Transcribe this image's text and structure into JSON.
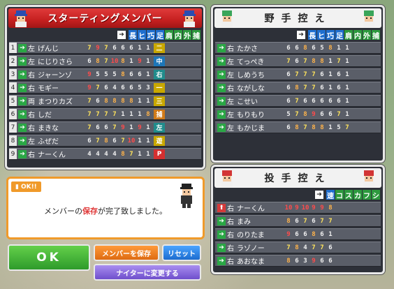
{
  "starting": {
    "title": "スターティングメンバー",
    "headers": [
      "長",
      "ヒ",
      "巧",
      "足",
      "肩",
      "内",
      "外",
      "捕"
    ],
    "players": [
      {
        "order": "1",
        "hand": "左",
        "name": "げんじ",
        "stats": [
          "7",
          "9",
          "7",
          "6",
          "6",
          "6",
          "1",
          "1"
        ],
        "pos": "二"
      },
      {
        "order": "2",
        "hand": "左",
        "name": "にじりさら",
        "stats": [
          "6",
          "8",
          "7",
          "10",
          "8",
          "1",
          "9",
          "1"
        ],
        "pos": "中"
      },
      {
        "order": "3",
        "hand": "右",
        "name": "ジャーンゾ",
        "stats": [
          "9",
          "5",
          "5",
          "5",
          "8",
          "6",
          "6",
          "1"
        ],
        "pos": "右"
      },
      {
        "order": "4",
        "hand": "右",
        "name": "モギー",
        "stats": [
          "9",
          "7",
          "6",
          "4",
          "6",
          "6",
          "5",
          "3"
        ],
        "pos": "一"
      },
      {
        "order": "5",
        "hand": "両",
        "name": "まつりカズ",
        "stats": [
          "7",
          "6",
          "8",
          "8",
          "8",
          "8",
          "1",
          "1"
        ],
        "pos": "三"
      },
      {
        "order": "6",
        "hand": "右",
        "name": "しだ",
        "stats": [
          "7",
          "7",
          "7",
          "7",
          "1",
          "1",
          "1",
          "8"
        ],
        "pos": "捕"
      },
      {
        "order": "7",
        "hand": "右",
        "name": "まきな",
        "stats": [
          "7",
          "6",
          "6",
          "7",
          "9",
          "1",
          "9",
          "1"
        ],
        "pos": "左"
      },
      {
        "order": "8",
        "hand": "左",
        "name": "ふぜだ",
        "stats": [
          "6",
          "7",
          "8",
          "6",
          "7",
          "10",
          "1",
          "1"
        ],
        "pos": "遊"
      },
      {
        "order": "9",
        "hand": "右",
        "name": "ナーくん",
        "stats": [
          "4",
          "4",
          "4",
          "4",
          "8",
          "7",
          "1",
          "1"
        ],
        "pos": "P"
      }
    ]
  },
  "fielders": {
    "title": "野手控え",
    "headers": [
      "長",
      "ヒ",
      "巧",
      "足",
      "肩",
      "内",
      "外",
      "捕"
    ],
    "players": [
      {
        "hand": "右",
        "name": "たかさ",
        "stats": [
          "6",
          "6",
          "8",
          "6",
          "5",
          "8",
          "1",
          "1"
        ]
      },
      {
        "hand": "左",
        "name": "てっぺき",
        "stats": [
          "7",
          "6",
          "7",
          "8",
          "8",
          "1",
          "7",
          "1"
        ]
      },
      {
        "hand": "左",
        "name": "しめうち",
        "stats": [
          "6",
          "7",
          "7",
          "7",
          "6",
          "1",
          "6",
          "1"
        ]
      },
      {
        "hand": "右",
        "name": "ながしな",
        "stats": [
          "6",
          "8",
          "7",
          "7",
          "6",
          "1",
          "6",
          "1"
        ]
      },
      {
        "hand": "左",
        "name": "こせい",
        "stats": [
          "6",
          "7",
          "6",
          "6",
          "6",
          "6",
          "6",
          "1"
        ]
      },
      {
        "hand": "左",
        "name": "もりもり",
        "stats": [
          "5",
          "7",
          "8",
          "9",
          "6",
          "6",
          "7",
          "1"
        ]
      },
      {
        "hand": "左",
        "name": "もかじま",
        "stats": [
          "6",
          "8",
          "7",
          "8",
          "8",
          "1",
          "5",
          "7"
        ]
      }
    ]
  },
  "pitchers": {
    "title": "投手控え",
    "headers": [
      "速",
      "コ",
      "ス",
      "カ",
      "フ",
      "シ"
    ],
    "players": [
      {
        "hand": "右",
        "name": "ナーくん",
        "stats": [
          "10",
          "9",
          "10",
          "9",
          "9",
          "8"
        ],
        "highlight": true
      },
      {
        "hand": "右",
        "name": "まみ",
        "stats": [
          "8",
          "6",
          "7",
          "6",
          "7",
          "7"
        ]
      },
      {
        "hand": "右",
        "name": "のりたま",
        "stats": [
          "9",
          "6",
          "6",
          "8",
          "6",
          "1"
        ]
      },
      {
        "hand": "右",
        "name": "ラゾノー",
        "stats": [
          "7",
          "8",
          "4",
          "7",
          "7",
          "6"
        ]
      },
      {
        "hand": "右",
        "name": "あおなま",
        "stats": [
          "8",
          "6",
          "3",
          "9",
          "6",
          "6"
        ]
      }
    ]
  },
  "message": {
    "tag": "OK!!",
    "before": "メンバーの",
    "highlight": "保存",
    "after": "が完了致しました。"
  },
  "buttons": {
    "ok": "OK",
    "save_members": "メンバーを保存",
    "reset": "リセット",
    "nighter": "ナイターに変更する"
  }
}
